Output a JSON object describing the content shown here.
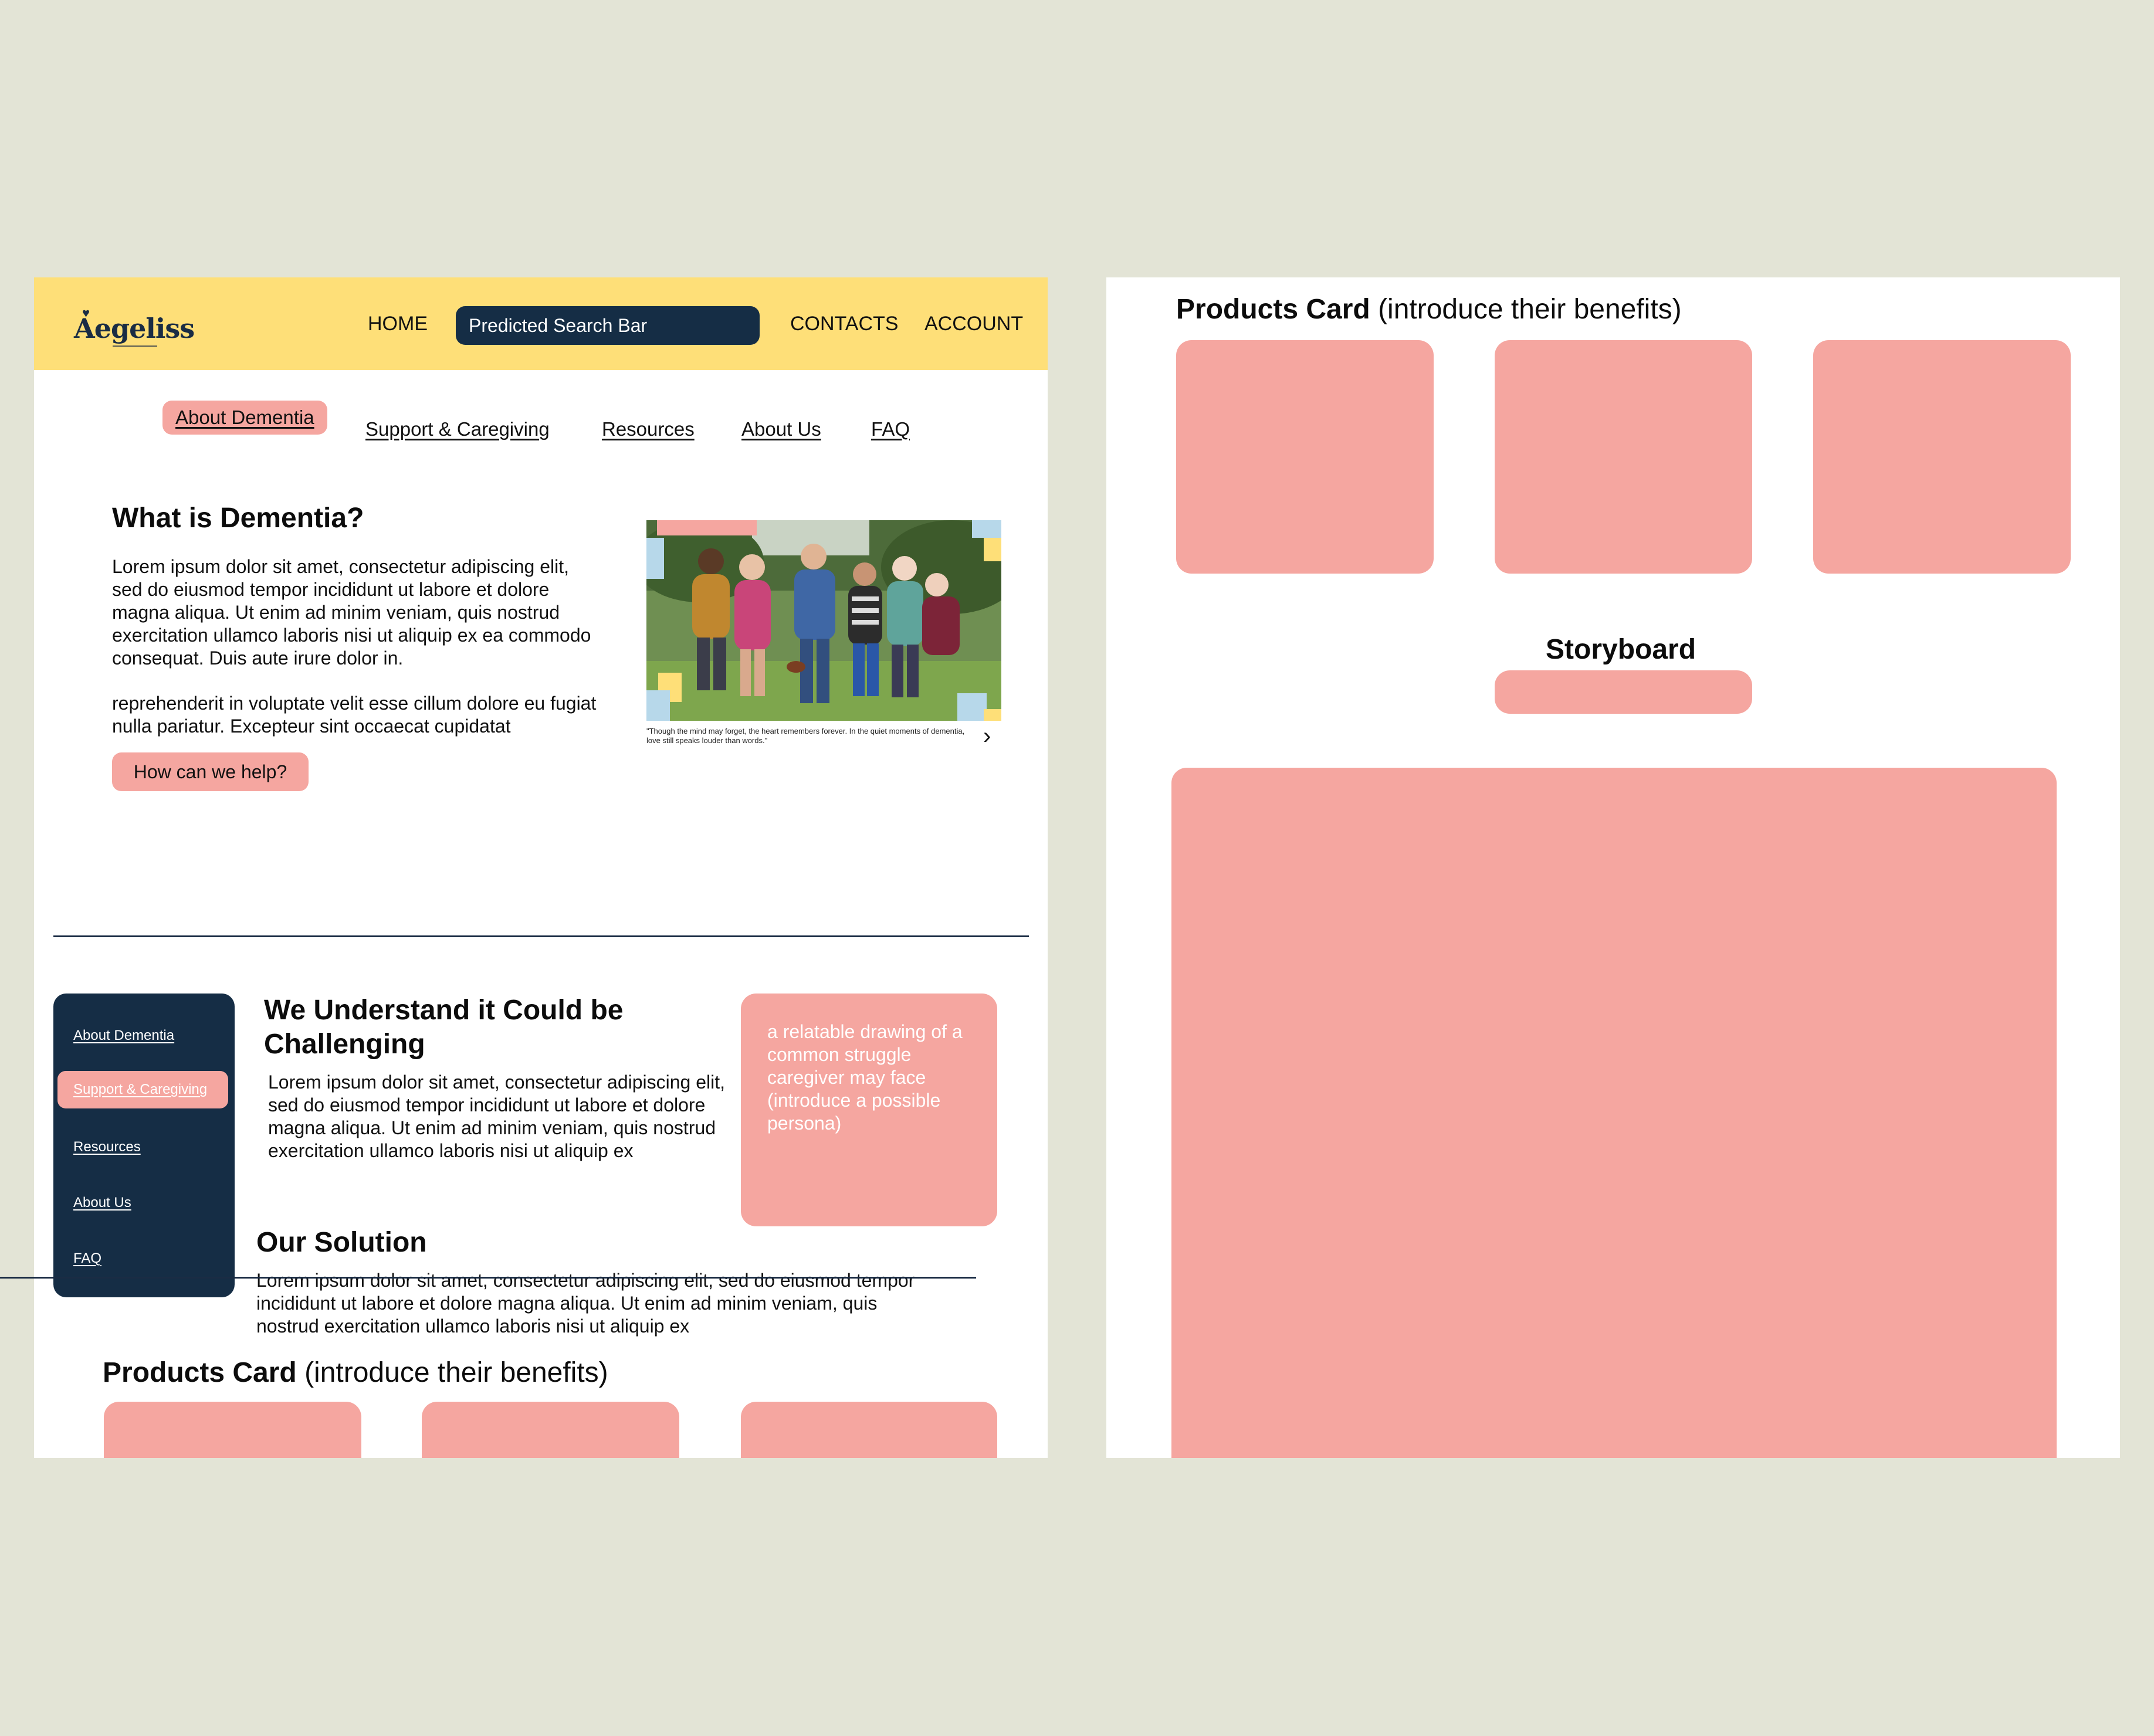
{
  "header": {
    "logo_text": "Aegeliss",
    "nav_home": "HOME",
    "search_placeholder": "Predicted Search Bar",
    "nav_contacts": "CONTACTS",
    "nav_account": "ACCOUNT"
  },
  "subnav": {
    "items": [
      "About Dementia",
      "Support & Caregiving",
      "Resources",
      "About Us",
      "FAQ"
    ],
    "active": "About Dementia"
  },
  "hero": {
    "title": "What is Dementia?",
    "paragraph1": "Lorem ipsum dolor sit amet, consectetur adipiscing elit, sed do eiusmod tempor incididunt ut labore et dolore magna aliqua. Ut enim ad minim veniam, quis nostrud exercitation ullamco laboris nisi ut aliquip ex ea commodo consequat. Duis aute irure dolor in.",
    "paragraph2": "reprehenderit in voluptate velit esse cillum dolore eu fugiat nulla pariatur. Excepteur sint occaecat cupidatat",
    "button": "How can we help?",
    "photo_caption": "\"Though the mind may forget, the heart remembers forever. In the quiet moments of dementia, love still speaks louder than words.\""
  },
  "sidenav": {
    "items": [
      "About Dementia",
      "Support & Caregiving",
      "Resources",
      "About Us",
      "FAQ"
    ],
    "active": "Support & Caregiving"
  },
  "challenge": {
    "title": "We Understand it Could be Challenging",
    "paragraph": "Lorem ipsum dolor sit amet, consectetur adipiscing elit, sed do eiusmod tempor incididunt ut labore et dolore magna aliqua. Ut enim ad minim veniam, quis nostrud exercitation ullamco laboris nisi ut aliquip ex",
    "card_text": "a relatable drawing of a common struggle caregiver may face (introduce a possible persona)"
  },
  "solution": {
    "title": "Our Solution",
    "paragraph": "Lorem ipsum dolor sit amet, consectetur adipiscing elit, sed do eiusmod tempor incididunt ut labore et dolore magna aliqua. Ut enim ad minim veniam, quis nostrud exercitation ullamco laboris nisi ut aliquip ex"
  },
  "products": {
    "title_bold": "Products Card",
    "title_rest": " (introduce their benefits)"
  },
  "storyboard": {
    "title": "Storyboard"
  },
  "colors": {
    "header_yellow": "#fedf78",
    "navy": "#152d45",
    "pink": "#f5a6a0",
    "background": "#e3e4d6"
  }
}
